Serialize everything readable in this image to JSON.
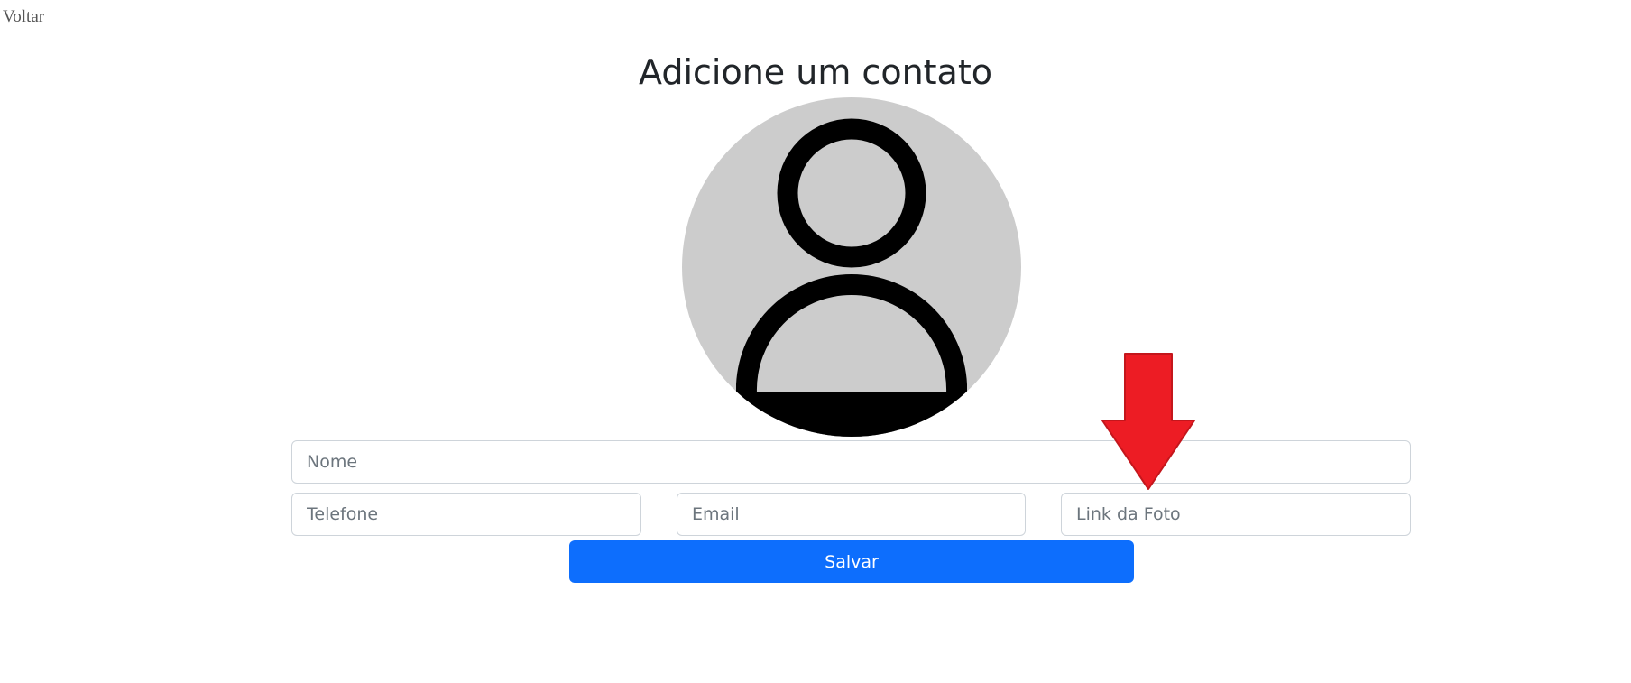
{
  "nav": {
    "back_label": "Voltar"
  },
  "page": {
    "title": "Adicione um contato"
  },
  "avatar": {
    "icon": "user-icon",
    "background_color": "#cccccc"
  },
  "form": {
    "name_placeholder": "Nome",
    "phone_placeholder": "Telefone",
    "email_placeholder": "Email",
    "photo_link_placeholder": "Link da Foto",
    "save_label": "Salvar"
  },
  "annotation": {
    "icon": "arrow-down-icon",
    "color": "#ed1c24"
  },
  "colors": {
    "primary": "#0d6efd",
    "back_link": "#555555"
  }
}
